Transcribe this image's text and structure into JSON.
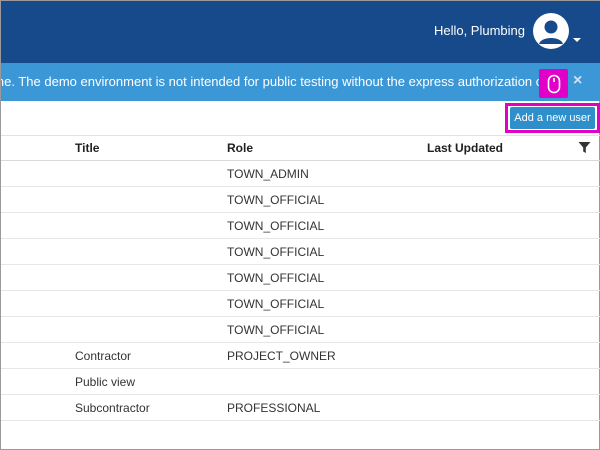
{
  "header": {
    "greeting": "Hello, Plumbing",
    "brand_color": "#174a8b"
  },
  "banner": {
    "text": "ny time. The demo environment is not intended for public testing without the express authorization o",
    "close_symbol": "×",
    "color": "#3b97d6"
  },
  "toolbar": {
    "add_user_label": "Add a new user"
  },
  "table": {
    "columns": [
      "Title",
      "Role",
      "Last Updated"
    ],
    "rows": [
      {
        "title": "",
        "role": "TOWN_ADMIN"
      },
      {
        "title": "",
        "role": "TOWN_OFFICIAL"
      },
      {
        "title": "",
        "role": "TOWN_OFFICIAL"
      },
      {
        "title": "",
        "role": "TOWN_OFFICIAL"
      },
      {
        "title": "",
        "role": "TOWN_OFFICIAL"
      },
      {
        "title": "",
        "role": "TOWN_OFFICIAL"
      },
      {
        "title": "",
        "role": "TOWN_OFFICIAL"
      },
      {
        "title": "Contractor",
        "role": "PROJECT_OWNER"
      },
      {
        "title": "Public view",
        "role": ""
      },
      {
        "title": "Subcontractor",
        "role": "PROFESSIONAL"
      }
    ]
  },
  "icons": {
    "avatar": "user-avatar-icon",
    "filter": "filter-icon",
    "cursor_marker": "mouse-icon"
  },
  "highlight_color": "#e000c8"
}
